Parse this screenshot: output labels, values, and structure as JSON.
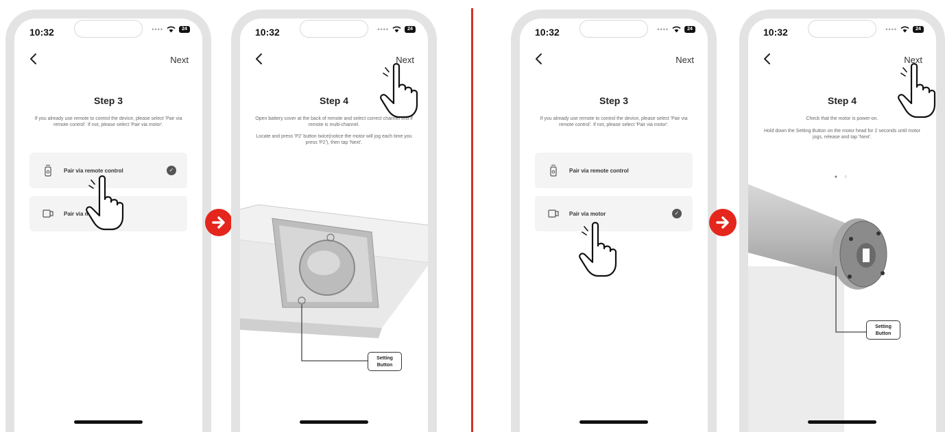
{
  "status": {
    "time": "10:32",
    "battery": "24"
  },
  "labels": {
    "next": "Next",
    "step3": "Step 3",
    "step4": "Step 4"
  },
  "step3": {
    "description": "If you already use remote to control the device, please select 'Pair via remote control'. If not, please select 'Pair via motor'.",
    "options": {
      "remote": "Pair via remote control",
      "motor": "Pair via motor"
    }
  },
  "remote_step4": {
    "paragraph1": "Open battery cover at the back of remote and select correct channel first if remote is multi-channel.",
    "paragraph2": "Locate and press 'P2' button twice(notice the motor will jog each time you press 'P2'), then tap 'Next'.",
    "callout": [
      "Setting",
      "Button"
    ]
  },
  "motor_step4": {
    "paragraph1": "Check that the motor is power-on.",
    "paragraph2": "Hold down the Setting Button on the motor head for 2 seconds until motor jogs, release and tap 'Next'.",
    "callout": [
      "Setting",
      "Button"
    ],
    "pager": "● ○"
  },
  "colors": {
    "accent": "#e4261c",
    "divider": "#d03024",
    "frame": "#e3e3e3"
  },
  "icons": [
    "chevron-left-icon",
    "wifi-icon",
    "battery-icon",
    "remote-icon",
    "motor-icon",
    "check-icon",
    "pointing-hand-icon",
    "arrow-right-icon"
  ]
}
